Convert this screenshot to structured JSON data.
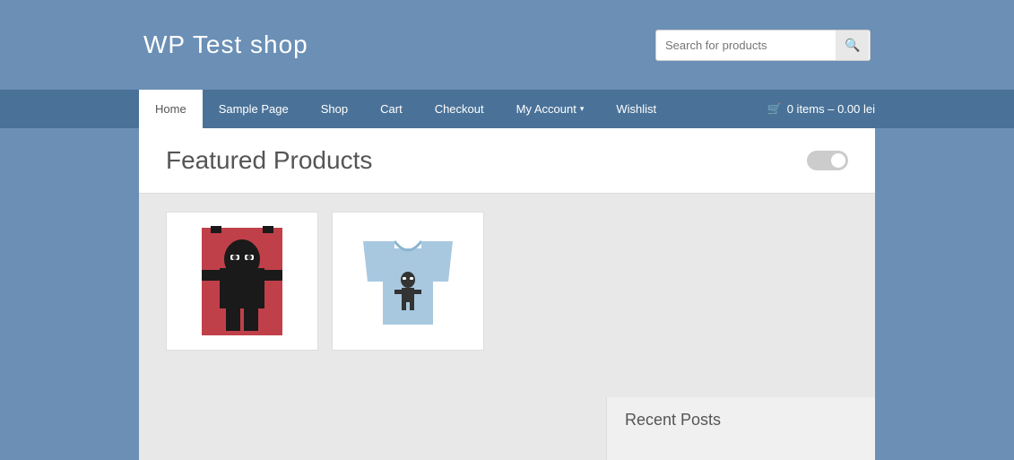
{
  "site": {
    "title": "WP Test shop"
  },
  "search": {
    "placeholder": "Search for products",
    "button_label": "🔍"
  },
  "nav": {
    "items": [
      {
        "label": "Home",
        "active": true
      },
      {
        "label": "Sample Page",
        "active": false
      },
      {
        "label": "Shop",
        "active": false
      },
      {
        "label": "Cart",
        "active": false
      },
      {
        "label": "Checkout",
        "active": false
      },
      {
        "label": "My Account",
        "active": false,
        "has_dropdown": true
      },
      {
        "label": "Wishlist",
        "active": false
      }
    ],
    "cart": {
      "items": "0 items",
      "separator": "–",
      "total": "0.00 lei"
    }
  },
  "main": {
    "featured_title": "Featured Products",
    "products": [
      {
        "id": 1,
        "type": "ninja-poster",
        "alt": "Ninja Poster Product"
      },
      {
        "id": 2,
        "type": "tshirt",
        "alt": "T-Shirt Product"
      }
    ]
  },
  "sidebar": {
    "recent_posts_title": "Recent Posts"
  }
}
